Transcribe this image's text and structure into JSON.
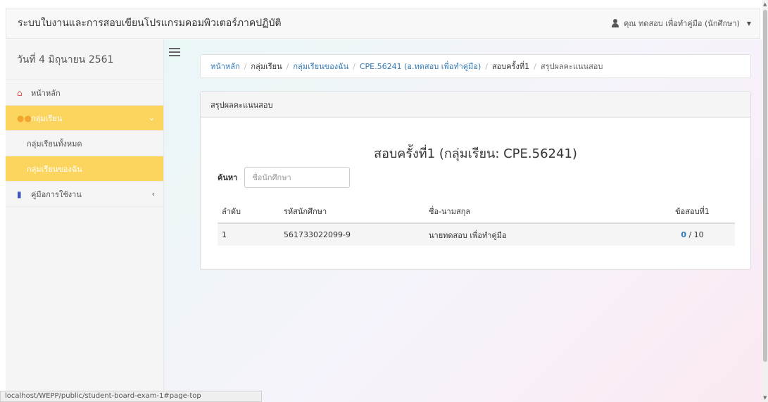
{
  "navbar": {
    "brand": "ระบบใบงานและการสอบเขียนโปรแกรมคอมพิวเตอร์ภาคปฏิบัติ",
    "user": "คุณ ทดสอบ เพื่อทำคู่มือ (นักศึกษา)"
  },
  "sidebar": {
    "date": "วันที่ 4 มิถุนายน 2561",
    "items": [
      {
        "label": "หน้าหลัก",
        "icon": "home-icon"
      },
      {
        "label": "กลุ่มเรียน",
        "icon": "users-icon"
      },
      {
        "label": "กลุ่มเรียนทั้งหมด"
      },
      {
        "label": "กลุ่มเรียนของฉัน"
      },
      {
        "label": "คู่มือการใช้งาน",
        "icon": "book-icon"
      }
    ]
  },
  "breadcrumb": {
    "items": [
      "หน้าหลัก",
      "กลุ่มเรียน",
      "กลุ่มเรียนของฉัน",
      "CPE.56241 (อ.ทดสอบ เพื่อทำคู่มือ)",
      "สอบครั้งที่1",
      "สรุปผลคะแนนสอบ"
    ]
  },
  "panel": {
    "heading": "สรุปผลคะแนนสอบ",
    "title": "สอบครั้งที่1 (กลุ่มเรียน: CPE.56241)",
    "search_label": "ค้นหา",
    "search_placeholder": "ชื่อนักศึกษา",
    "table": {
      "headers": [
        "ลำดับ",
        "รหัสนักศึกษา",
        "ชื่อ-นามสกุล",
        "ข้อสอบที่1"
      ],
      "rows": [
        {
          "no": "1",
          "id": "561733022099-9",
          "name": "นายทดสอบ เพื่อทำคู่มือ",
          "score": "0",
          "total": "10"
        }
      ]
    }
  },
  "statusbar": "localhost/WEPP/public/student-board-exam-1#page-top",
  "colors": {
    "accent": "#fbd55e",
    "link": "#337ab7"
  }
}
